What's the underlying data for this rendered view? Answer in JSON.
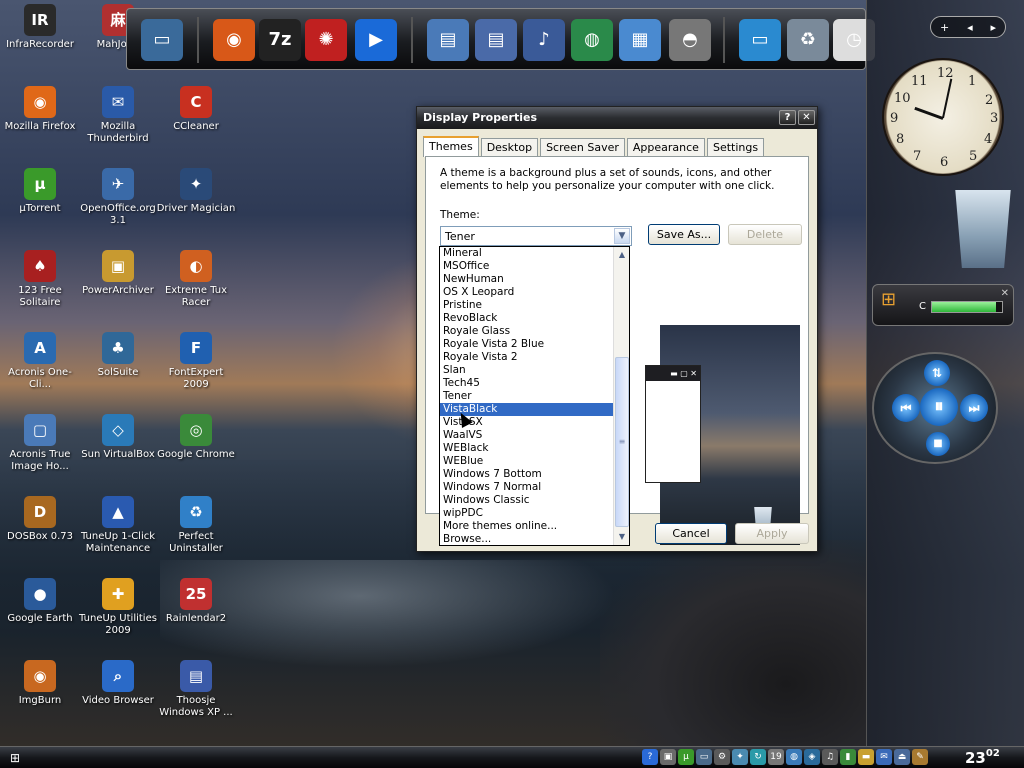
{
  "desktop_icons": [
    {
      "label": "InfraRecorder",
      "icon": "infrarecorder-icon",
      "glyph": "IR",
      "color": "#2a2a2a"
    },
    {
      "label": "MahJong",
      "icon": "mahjong-icon",
      "glyph": "麻",
      "color": "#b03030"
    },
    {
      "label": "Mozilla Firefox",
      "icon": "firefox-icon",
      "glyph": "◉",
      "color": "#e06818"
    },
    {
      "label": "Mozilla Thunderbird",
      "icon": "thunderbird-icon",
      "glyph": "✉",
      "color": "#2a5aa8"
    },
    {
      "label": "CCleaner",
      "icon": "ccleaner-icon",
      "glyph": "C",
      "color": "#c83020"
    },
    {
      "label": "µTorrent",
      "icon": "utorrent-icon",
      "glyph": "µ",
      "color": "#3a9a2a"
    },
    {
      "label": "OpenOffice.org 3.1",
      "icon": "openoffice-icon",
      "glyph": "✈",
      "color": "#3a6aa8"
    },
    {
      "label": "Driver Magician",
      "icon": "driver-magician-icon",
      "glyph": "✦",
      "color": "#2a4a78"
    },
    {
      "label": "123 Free Solitaire",
      "icon": "solitaire-icon",
      "glyph": "♠",
      "color": "#a82020"
    },
    {
      "label": "PowerArchiver",
      "icon": "powerarchiver-icon",
      "glyph": "▣",
      "color": "#c89a30"
    },
    {
      "label": "Extreme Tux Racer",
      "icon": "tux-racer-icon",
      "glyph": "◐",
      "color": "#d06020"
    },
    {
      "label": "Acronis One-Cli...",
      "icon": "acronis-icon",
      "glyph": "A",
      "color": "#2a6ab0"
    },
    {
      "label": "SolSuite",
      "icon": "solsuite-icon",
      "glyph": "♣",
      "color": "#306898"
    },
    {
      "label": "FontExpert 2009",
      "icon": "fontexpert-icon",
      "glyph": "F",
      "color": "#2060b0"
    },
    {
      "label": "Acronis True Image Ho...",
      "icon": "acronis-true-image-icon",
      "glyph": "▢",
      "color": "#4a7ab8"
    },
    {
      "label": "Sun VirtualBox",
      "icon": "virtualbox-icon",
      "glyph": "◇",
      "color": "#2a7ab8"
    },
    {
      "label": "Google Chrome",
      "icon": "chrome-icon",
      "glyph": "◎",
      "color": "#3a8a3a"
    },
    {
      "label": "DOSBox 0.73",
      "icon": "dosbox-icon",
      "glyph": "D",
      "color": "#a86820"
    },
    {
      "label": "TuneUp 1-Click Maintenance",
      "icon": "tuneup-maintenance-icon",
      "glyph": "▲",
      "color": "#2a5ab0"
    },
    {
      "label": "Perfect Uninstaller",
      "icon": "uninstaller-icon",
      "glyph": "♻",
      "color": "#3080c8"
    },
    {
      "label": "Google Earth",
      "icon": "google-earth-icon",
      "glyph": "●",
      "color": "#2a5a9a"
    },
    {
      "label": "TuneUp Utilities 2009",
      "icon": "tuneup-utilities-icon",
      "glyph": "✚",
      "color": "#e0a020"
    },
    {
      "label": "Rainlendar2",
      "icon": "rainlendar-icon",
      "glyph": "25",
      "color": "#c03030"
    },
    {
      "label": "ImgBurn",
      "icon": "imgburn-icon",
      "glyph": "◉",
      "color": "#c86820"
    },
    {
      "label": "Video Browser",
      "icon": "video-browser-icon",
      "glyph": "⌕",
      "color": "#2a6ac8"
    },
    {
      "label": "Thoosje Windows XP ...",
      "icon": "thoosje-icon",
      "glyph": "▤",
      "color": "#3a5aa8"
    }
  ],
  "dock_items": [
    {
      "icon": "computer-icon",
      "glyph": "▭",
      "color": "#3a6a9a"
    },
    {
      "icon": "firefox-icon",
      "glyph": "◉",
      "color": "#d85818"
    },
    {
      "icon": "7zip-icon",
      "glyph": "7z",
      "color": "#222"
    },
    {
      "icon": "bug-icon",
      "glyph": "✺",
      "color": "#c02020"
    },
    {
      "icon": "media-player-icon",
      "glyph": "▶",
      "color": "#1a6ad8"
    },
    {
      "icon": "documents-icon",
      "glyph": "▤",
      "color": "#4a7ab8"
    },
    {
      "icon": "pictures-icon",
      "glyph": "▤",
      "color": "#4a6aa8"
    },
    {
      "icon": "music-icon",
      "glyph": "♪",
      "color": "#3a5a98"
    },
    {
      "icon": "network-icon",
      "glyph": "◍",
      "color": "#2a8a4a"
    },
    {
      "icon": "control-panel-icon",
      "glyph": "▦",
      "color": "#4a8ad0"
    },
    {
      "icon": "dvd-drive-icon",
      "glyph": "◓",
      "color": "#777"
    },
    {
      "icon": "display-icon",
      "glyph": "▭",
      "color": "#2a8ad0"
    },
    {
      "icon": "recycle-bin-icon",
      "glyph": "♻",
      "color": "#7a8a9a"
    },
    {
      "icon": "clock-icon",
      "glyph": "◷",
      "color": "#ddd"
    }
  ],
  "sidebar": {
    "controls": {
      "add": "+",
      "prev": "◂",
      "next": "▸"
    },
    "cpu_label": "C",
    "cpu_level": 0.92
  },
  "window": {
    "title": "Display Properties",
    "help_btn": "?",
    "close_btn": "✕",
    "tabs": [
      "Themes",
      "Desktop",
      "Screen Saver",
      "Appearance",
      "Settings"
    ],
    "active_tab": "Themes",
    "description": "A theme is a background plus a set of sounds, icons, and other elements to help you personalize your computer with one click.",
    "theme_label": "Theme:",
    "theme_value": "Tener",
    "save_as": "Save As...",
    "delete": "Delete",
    "cancel": "Cancel",
    "apply": "Apply"
  },
  "dropdown": {
    "items": [
      "Mineral",
      "MSOffice",
      "NewHuman",
      "OS X Leopard",
      "Pristine",
      "RevoBlack",
      "Royale Glass",
      "Royale Vista 2 Blue",
      "Royale Vista 2",
      "Slan",
      "Tech45",
      "Tener",
      "VistaBlack",
      "VistaSX",
      "WaalVS",
      "WEBlack",
      "WEBlue",
      "Windows 7 Bottom",
      "Windows 7 Normal",
      "Windows Classic",
      "wipPDC",
      "More themes online...",
      "Browse..."
    ],
    "selected": "VistaBlack"
  },
  "taskbar": {
    "time_hour": "23",
    "time_min": "02",
    "tray": [
      {
        "icon": "help-icon",
        "glyph": "?",
        "color": "#2a6ad8"
      },
      {
        "icon": "tray-window-icon",
        "glyph": "▣",
        "color": "#6a6a6a"
      },
      {
        "icon": "utorrent-tray-icon",
        "glyph": "µ",
        "color": "#3a9a2a"
      },
      {
        "icon": "tray-monitor-icon",
        "glyph": "▭",
        "color": "#4a6a8a"
      },
      {
        "icon": "gear-icon",
        "glyph": "⚙",
        "color": "#5a5a5a"
      },
      {
        "icon": "tray-star-icon",
        "glyph": "✦",
        "color": "#4a8ab0"
      },
      {
        "icon": "refresh-icon",
        "glyph": "↻",
        "color": "#2a9aa8"
      },
      {
        "icon": "calendar-icon",
        "glyph": "19",
        "color": "#777"
      },
      {
        "icon": "network-tray-icon",
        "glyph": "◍",
        "color": "#3a7ab8"
      },
      {
        "icon": "shield-icon",
        "glyph": "◈",
        "color": "#2a6a9a"
      },
      {
        "icon": "volume-icon",
        "glyph": "♫",
        "color": "#5a5a5a"
      },
      {
        "icon": "battery-icon",
        "glyph": "▮",
        "color": "#3a8a3a"
      },
      {
        "icon": "folder-icon",
        "glyph": "▬",
        "color": "#c8a030"
      },
      {
        "icon": "tray-chat-icon",
        "glyph": "✉",
        "color": "#3a6ab8"
      },
      {
        "icon": "eject-icon",
        "glyph": "⏏",
        "color": "#4a6a9a"
      },
      {
        "icon": "tools-icon",
        "glyph": "✎",
        "color": "#a87a30"
      }
    ]
  }
}
